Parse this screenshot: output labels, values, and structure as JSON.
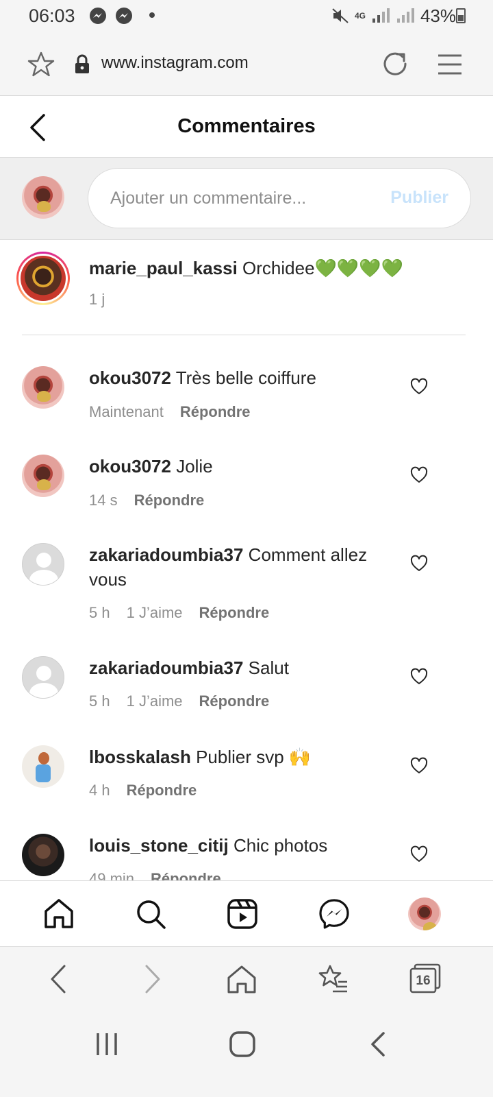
{
  "status_bar": {
    "time": "06:03",
    "network": "4G",
    "battery": "43%",
    "notification_icons": [
      "messenger-icon",
      "messenger-icon"
    ]
  },
  "browser": {
    "url": "www.instagram.com"
  },
  "header": {
    "title": "Commentaires"
  },
  "composer": {
    "placeholder": "Ajouter un commentaire...",
    "publish_label": "Publier"
  },
  "caption": {
    "username": "marie_paul_kassi",
    "text": "Orchidee💚💚💚💚",
    "time": "1 j"
  },
  "comments": [
    {
      "username": "okou3072",
      "text": "Très belle coiffure",
      "time": "Maintenant",
      "likes": "",
      "reply_label": "Répondre"
    },
    {
      "username": "okou3072",
      "text": "Jolie",
      "time": "14 s",
      "likes": "",
      "reply_label": "Répondre"
    },
    {
      "username": "zakariadoumbia37",
      "text": "Comment allez vous",
      "time": "5 h",
      "likes": "1 J’aime",
      "reply_label": "Répondre"
    },
    {
      "username": "zakariadoumbia37",
      "text": "Salut",
      "time": "5 h",
      "likes": "1 J’aime",
      "reply_label": "Répondre"
    },
    {
      "username": "lbosskalash",
      "text": "Publier svp 🙌",
      "time": "4 h",
      "likes": "",
      "reply_label": "Répondre"
    },
    {
      "username": "louis_stone_citij",
      "text": "Chic photos",
      "time": "49 min",
      "likes": "",
      "reply_label": "Répondre"
    }
  ],
  "ig_nav": [
    "home-icon",
    "search-icon",
    "reels-icon",
    "messenger-icon",
    "profile-avatar"
  ],
  "browser_nav": {
    "tab_count": "16"
  },
  "colors": {
    "publish_disabled": "#c8e3fb",
    "secondary_text": "#8e8e8e",
    "divider": "#dbdbdb"
  }
}
